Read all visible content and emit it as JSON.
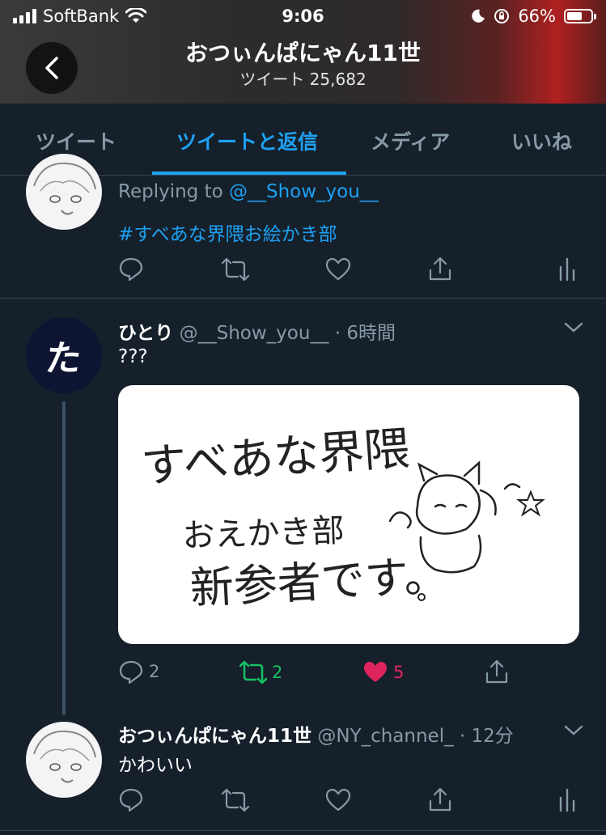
{
  "status_bar": {
    "carrier": "SoftBank",
    "time": "9:06",
    "battery": "66%",
    "battery_level": 0.66
  },
  "header": {
    "title": "おつぃんぱにゃん11世",
    "subtitle": "ツイート 25,682"
  },
  "tabs": [
    {
      "label": "ツイート",
      "active": false
    },
    {
      "label": "ツイートと返信",
      "active": true
    },
    {
      "label": "メディア",
      "active": false
    },
    {
      "label": "いいね",
      "active": false
    }
  ],
  "tweet1": {
    "replying_prefix": "Replying to",
    "replying_handle": "@__Show_you__",
    "hashtag": "#すべあな界隈お絵かき部"
  },
  "tweet2": {
    "name": "ひとり",
    "handle_time": "@__Show_you__ · 6時間",
    "text": "???",
    "image_text": [
      "すべあな界隈",
      "おえかき部",
      "新参者です。"
    ],
    "replies": "2",
    "retweets": "2",
    "likes": "5",
    "avatar_char": "た"
  },
  "tweet3": {
    "name": "おつぃんぱにゃん11世",
    "handle_time": "@NY_channel_ · 12分",
    "text": "かわいい"
  },
  "colors": {
    "background": "#15202b",
    "accent": "#1da1f2",
    "retweet": "#17bf63",
    "like": "#e0245e",
    "muted": "#8899a6"
  }
}
